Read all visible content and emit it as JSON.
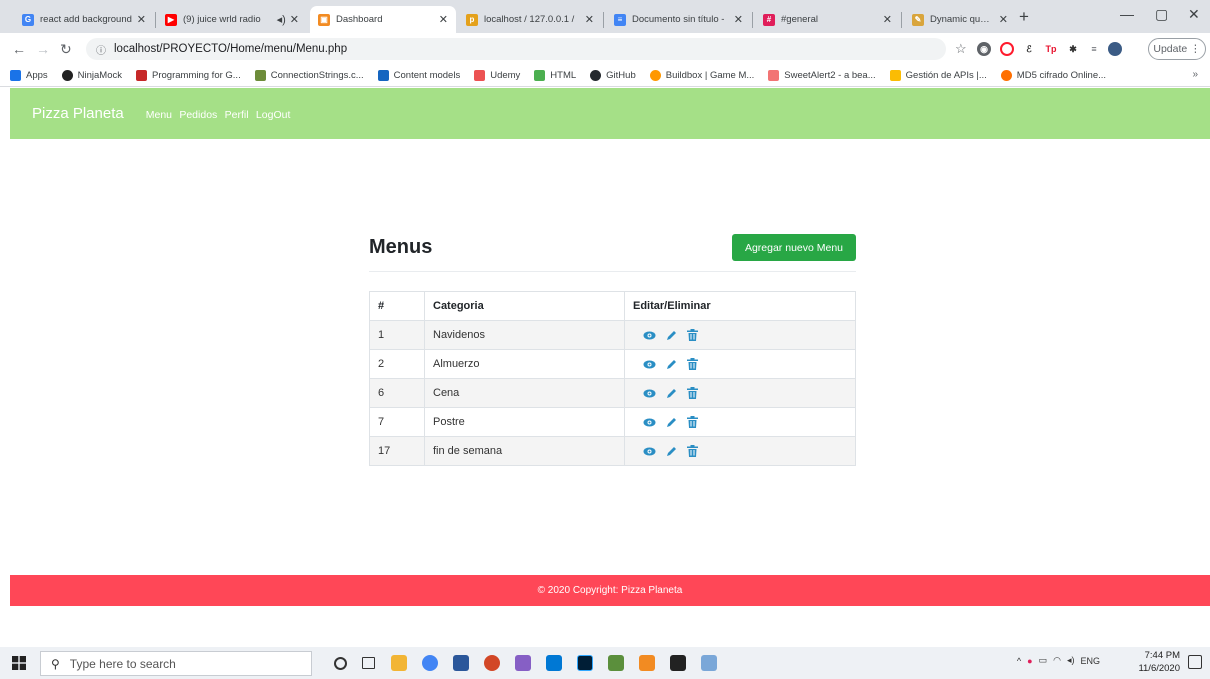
{
  "browser": {
    "tabs": [
      {
        "label": "react add background",
        "color": "#4285f4",
        "glyph": "G"
      },
      {
        "label": "(9) juice wrld radio",
        "color": "#ff0000",
        "glyph": "▶"
      },
      {
        "label": "Dashboard",
        "color": "#f28b22",
        "glyph": "▣",
        "active": true
      },
      {
        "label": "localhost / 127.0.0.1 / ",
        "color": "#e4a11b",
        "glyph": "p"
      },
      {
        "label": "Documento sin título - ",
        "color": "#4285f4",
        "glyph": "≡"
      },
      {
        "label": "#general",
        "color": "#e01e5a",
        "glyph": "#"
      },
      {
        "label": "Dynamic query building",
        "color": "#d9a53c",
        "glyph": "✎"
      }
    ],
    "url": "localhost/PROYECTO/Home/menu/Menu.php",
    "update_label": "Update",
    "bookmarks": [
      {
        "label": "Apps",
        "color": "#1a73e8"
      },
      {
        "label": "NinjaMock",
        "color": "#222222"
      },
      {
        "label": "Programming for G...",
        "color": "#c62828"
      },
      {
        "label": "ConnectionStrings.c...",
        "color": "#6d8c3a"
      },
      {
        "label": "Content models",
        "color": "#1565c0"
      },
      {
        "label": "Udemy",
        "color": "#ec5252"
      },
      {
        "label": "HTML",
        "color": "#4caf50"
      },
      {
        "label": "GitHub",
        "color": "#24292e"
      },
      {
        "label": "Buildbox | Game M...",
        "color": "#ff9800"
      },
      {
        "label": "SweetAlert2 - a bea...",
        "color": "#f27474"
      },
      {
        "label": "Gestión de APIs |...",
        "color": "#fbbc04"
      },
      {
        "label": "MD5 cifrado Online...",
        "color": "#ff6f00"
      }
    ]
  },
  "site": {
    "brand": "Pizza Planeta",
    "nav": [
      "Menu",
      "Pedidos",
      "Perfil",
      "LogOut"
    ],
    "title": "Menus",
    "add_button": "Agregar nuevo Menu",
    "table": {
      "headers": [
        "#",
        "Categoria",
        "Editar/Eliminar"
      ],
      "rows": [
        {
          "id": "1",
          "categoria": "Navidenos"
        },
        {
          "id": "2",
          "categoria": "Almuerzo"
        },
        {
          "id": "6",
          "categoria": "Cena"
        },
        {
          "id": "7",
          "categoria": "Postre"
        },
        {
          "id": "17",
          "categoria": "fin de semana"
        }
      ]
    },
    "footer": "© 2020 Copyright: Pizza Planeta",
    "colors": {
      "navbar": "#a5e087",
      "button": "#28a745",
      "footer": "#ff4757",
      "action_icons": "#2a8ec4"
    }
  },
  "taskbar": {
    "search_placeholder": "Type here to search",
    "language": "ENG",
    "time": "7:44 PM",
    "date": "11/6/2020"
  }
}
